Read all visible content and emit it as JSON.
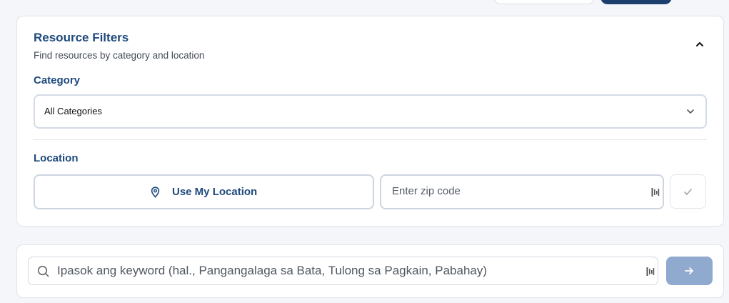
{
  "filters": {
    "title": "Resource Filters",
    "subtitle": "Find resources by category and location",
    "category": {
      "label": "Category",
      "selected": "All Categories"
    },
    "location": {
      "label": "Location",
      "use_location_label": "Use My Location",
      "zip_placeholder": "Enter zip code"
    }
  },
  "search": {
    "placeholder": "Ipasok ang keyword (hal., Pangangalaga sa Bata, Tulong sa Pagkain, Pabahay)"
  },
  "icons": {
    "collapse": "chevron-up-icon",
    "select": "chevron-down-icon",
    "location": "map-pin-icon",
    "confirm": "check-icon",
    "search": "search-icon",
    "submit": "arrow-right-icon"
  },
  "colors": {
    "heading": "#1e4a7d",
    "primary_button": "#1c3f6e",
    "submit_disabled": "#8fa9cf"
  }
}
